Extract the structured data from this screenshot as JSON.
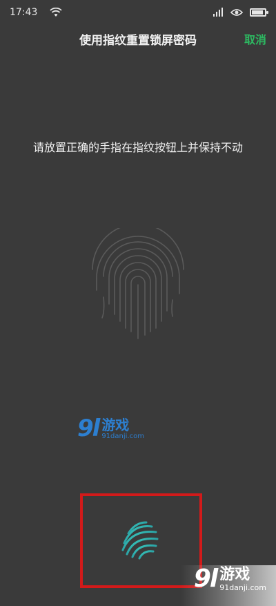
{
  "status_bar": {
    "time": "17:43",
    "wifi_icon": "wifi-icon",
    "signal_icon": "signal-icon",
    "eye_icon": "eye-icon",
    "battery_icon": "battery-icon"
  },
  "header": {
    "title": "使用指纹重置锁屏密码",
    "cancel_label": "取消"
  },
  "main": {
    "instruction": "请放置正确的手指在指纹按钮上并保持不动",
    "fingerprint_icon": "fingerprint-icon"
  },
  "watermark": {
    "logo": "9l",
    "name": "游戏",
    "url": "91danji.com"
  },
  "sensor": {
    "icon": "fingerprint-sensor-icon"
  },
  "watermark_bottom": {
    "logo": "9l",
    "name": "游戏",
    "url": "91danji.com"
  },
  "colors": {
    "background": "#3a3a3a",
    "accent": "#2db861",
    "highlight": "#d21a1a",
    "watermark": "#2d7fd0"
  }
}
